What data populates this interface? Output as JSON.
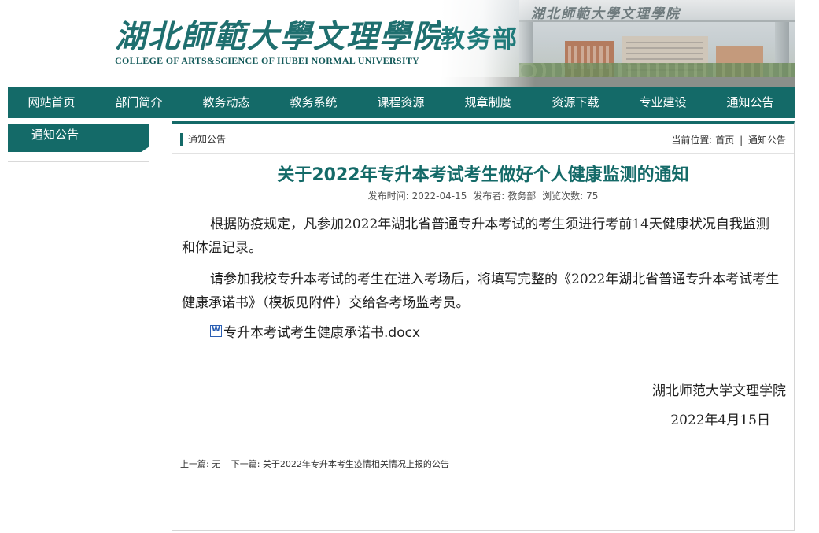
{
  "header": {
    "logo_cn": "湖北師範大學文理學院",
    "logo_en": "COLLEGE OF ARTS&SCIENCE OF HUBEI NORMAL UNIVERSITY",
    "dept": "教务部",
    "gate_text": "湖北師範大學文理學院"
  },
  "nav": {
    "items": [
      "网站首页",
      "部门简介",
      "教务动态",
      "教务系统",
      "课程资源",
      "规章制度",
      "资源下载",
      "专业建设",
      "通知公告"
    ]
  },
  "sidebar": {
    "tab": "通知公告"
  },
  "content_head": {
    "title": "通知公告",
    "crumb_label": "当前位置:",
    "crumb_home": "首页",
    "crumb_sep": "|",
    "crumb_current": "通知公告"
  },
  "article": {
    "title": "关于2022年专升本考试考生做好个人健康监测的通知",
    "meta_date_label": "发布时间:",
    "meta_date": "2022-04-15",
    "meta_author_label": "发布者:",
    "meta_author": "教务部",
    "meta_views_label": "浏览次数:",
    "meta_views": "75",
    "p1": "根据防疫规定，凡参加2022年湖北省普通专升本考试的考生须进行考前14天健康状况自我监测和体温记录。",
    "p2": "请参加我校专升本考试的考生在进入考场后，将填写完整的《2022年湖北省普通专升本考试考生健康承诺书》（模板见附件）交给各考场监考员。",
    "attachment": "专升本考试考生健康承诺书.docx",
    "signature": "湖北师范大学文理学院",
    "date": "2022年4月15日"
  },
  "prevnext": {
    "prev_label": "上一篇:",
    "prev": "无",
    "next_label": "下一篇:",
    "next": "关于2022年专升本考生疫情相关情况上报的公告"
  }
}
